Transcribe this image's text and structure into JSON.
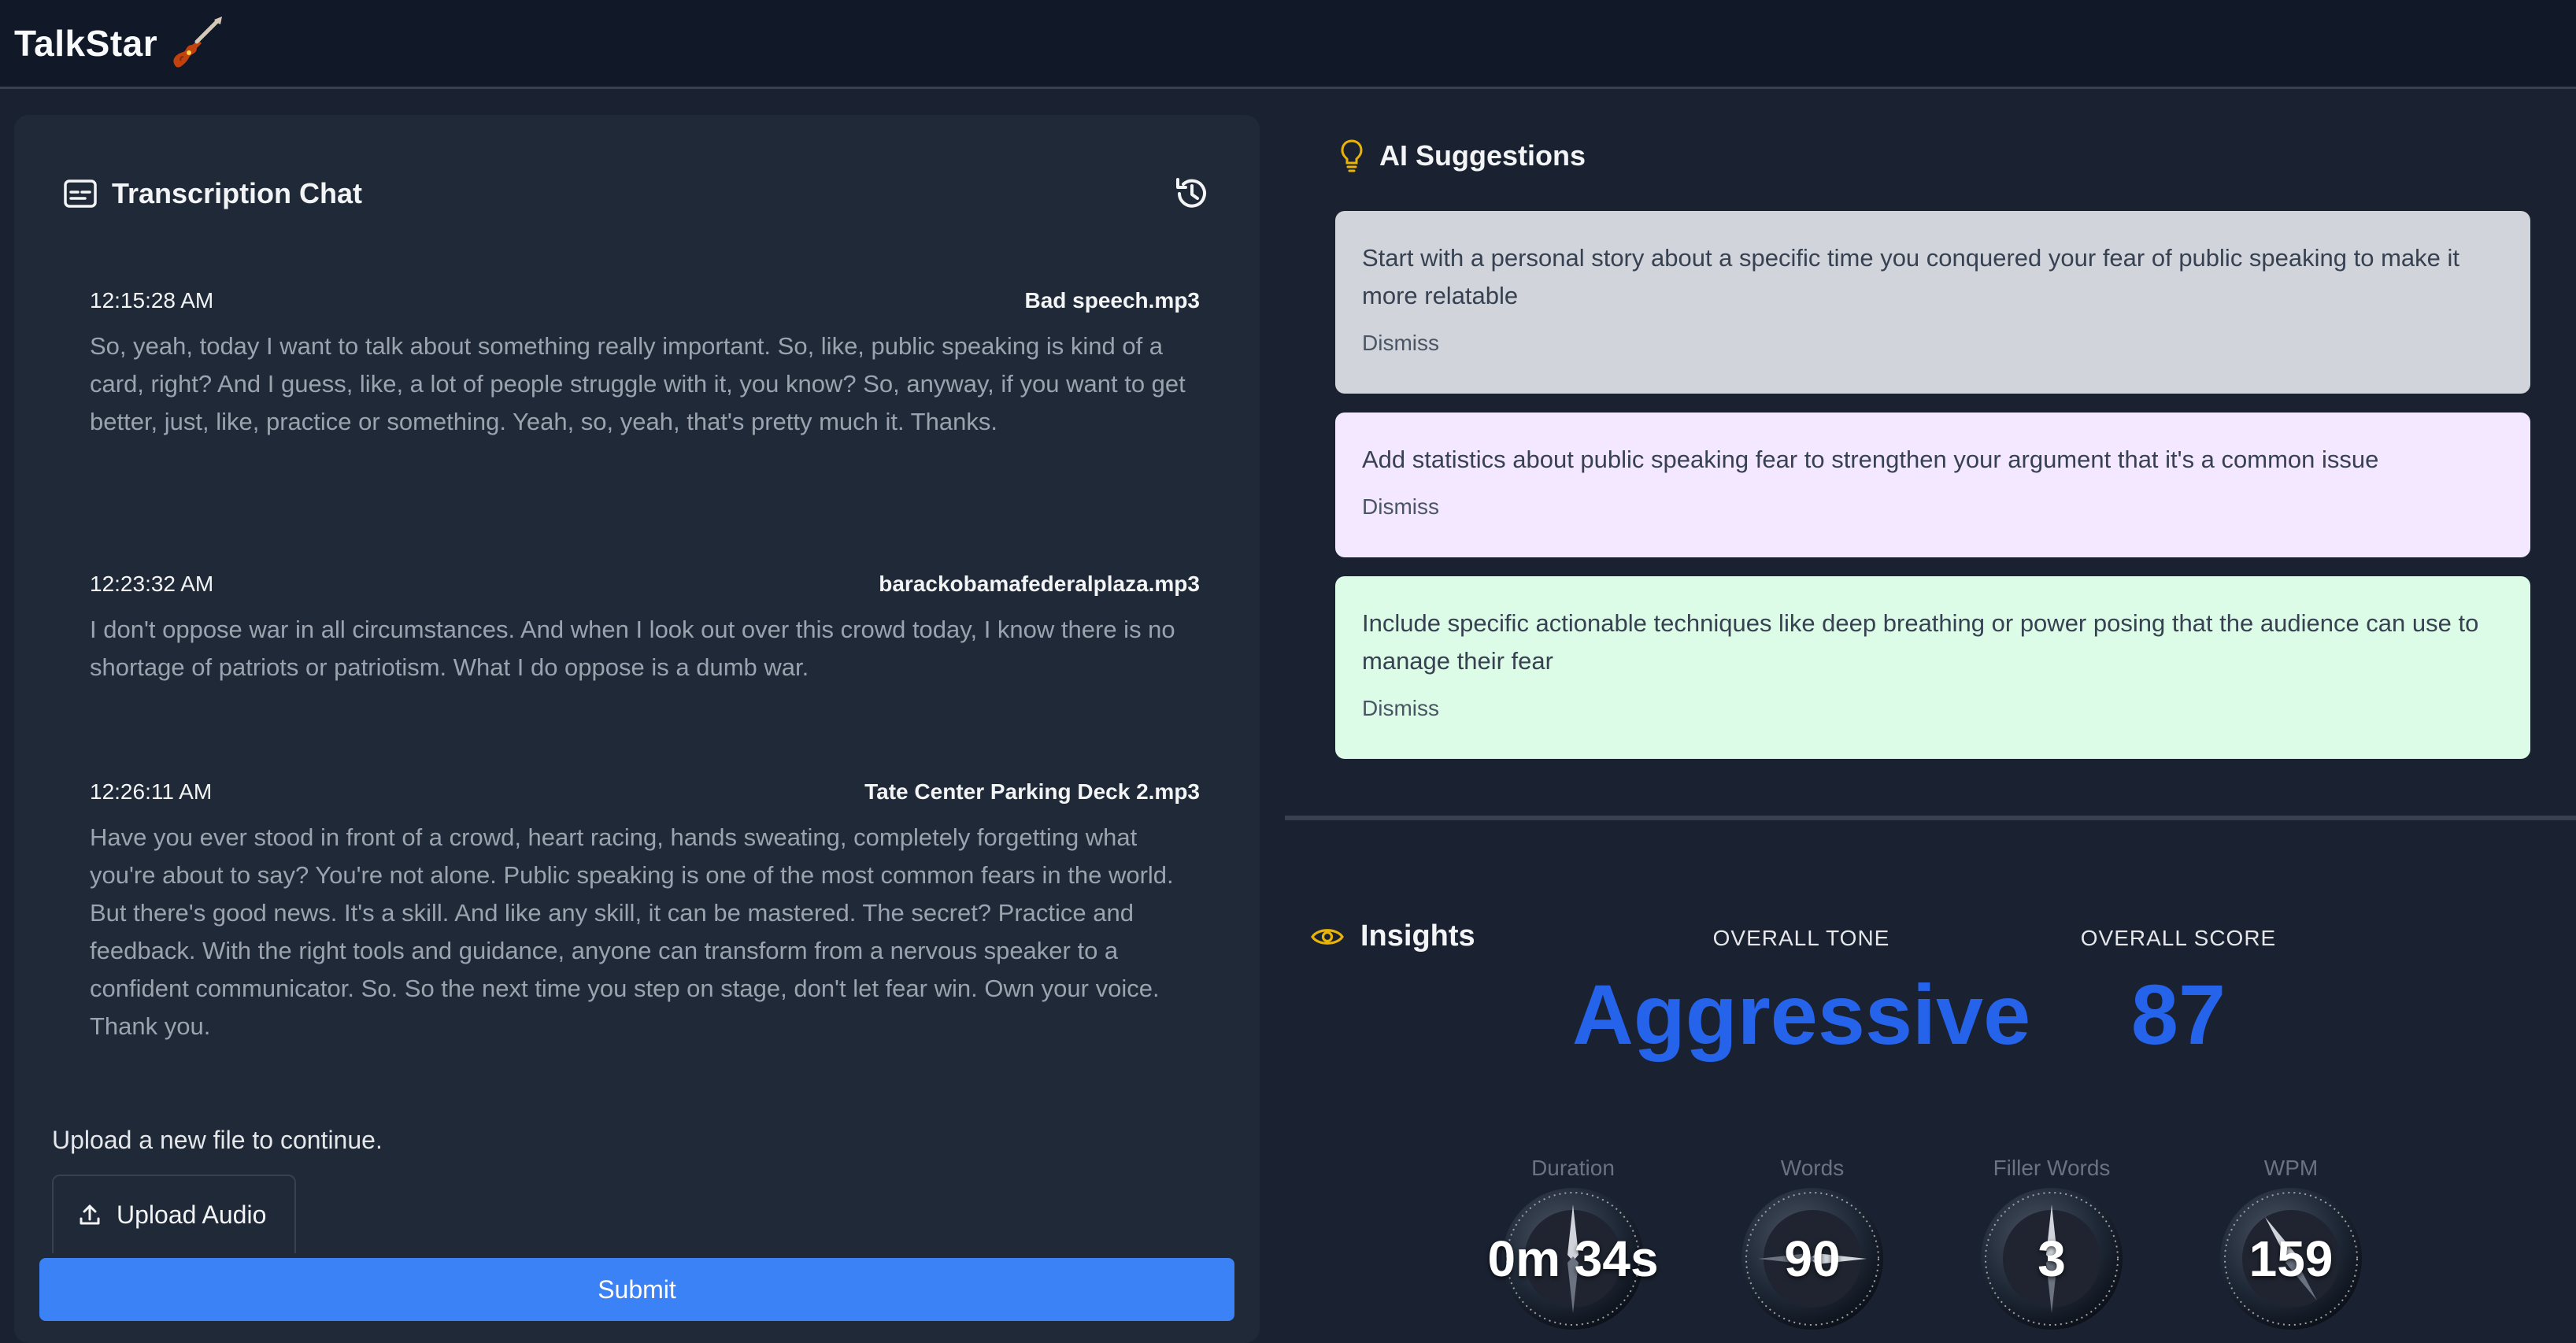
{
  "app": {
    "brand": "TalkStar",
    "logo_icon": "guitar-icon"
  },
  "chat": {
    "title": "Transcription Chat",
    "messages": [
      {
        "time": "12:15:28 AM",
        "file": "Bad speech.mp3",
        "text": "So, yeah, today I want to talk about something really important. So, like, public speaking is kind of a card, right? And I guess, like, a lot of people struggle with it, you know? So, anyway, if you want to get better, just, like, practice or something. Yeah, so, yeah, that's pretty much it. Thanks."
      },
      {
        "time": "12:23:32 AM",
        "file": "barackobamafederalplaza.mp3",
        "text": "I don't oppose war in all circumstances. And when I look out over this crowd today, I know there is no shortage of patriots or patriotism. What I do oppose is a dumb war."
      },
      {
        "time": "12:26:11 AM",
        "file": "Tate Center Parking Deck 2.mp3",
        "text": "Have you ever stood in front of a crowd, heart racing, hands sweating, completely forgetting what you're about to say? You're not alone. Public speaking is one of the most common fears in the world. But there's good news. It's a skill. And like any skill, it can be mastered. The secret? Practice and feedback. With the right tools and guidance, anyone can transform from a nervous speaker to a confident communicator. So. So the next time you step on stage, don't let fear win. Own your voice. Thank you."
      }
    ],
    "upload_hint": "Upload a new file to continue.",
    "upload_label": "Upload Audio",
    "submit_label": "Submit"
  },
  "suggestions": {
    "title": "AI Suggestions",
    "items": [
      {
        "text": "Start with a personal story about a specific time you conquered your fear of public speaking to make it more relatable",
        "dismiss": "Dismiss",
        "bg": "#d1d5db"
      },
      {
        "text": "Add statistics about public speaking fear to strengthen your argument that it's a common issue",
        "dismiss": "Dismiss",
        "bg": "#f3e8ff"
      },
      {
        "text": "Include specific actionable techniques like deep breathing or power posing that the audience can use to manage their fear",
        "dismiss": "Dismiss",
        "bg": "#dcfce7"
      }
    ]
  },
  "insights": {
    "title": "Insights",
    "tone_label": "OVERALL TONE",
    "tone_value": "Aggressive",
    "score_label": "OVERALL SCORE",
    "score_value": "87",
    "stats": [
      {
        "label": "Duration",
        "value": "0m 34s"
      },
      {
        "label": "Words",
        "value": "90"
      },
      {
        "label": "Filler Words",
        "value": "3"
      },
      {
        "label": "WPM",
        "value": "159"
      }
    ]
  },
  "colors": {
    "accent": "#3b82f6",
    "score_blue": "#2563eb",
    "icon_yellow": "#eab308"
  }
}
